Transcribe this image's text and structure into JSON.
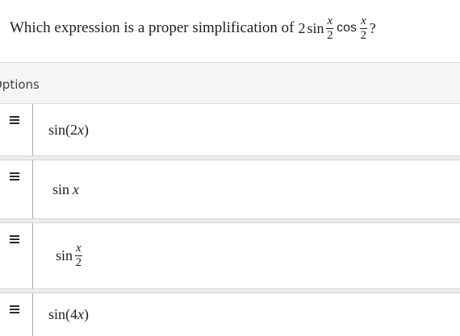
{
  "question": {
    "text": "Which expression is a proper simplification of",
    "coefficient": "2",
    "fn1": "sin",
    "fn2": "cos",
    "frac_numerator": "x",
    "frac_denominator": "2",
    "end": "?"
  },
  "faint_marks": "· · ·",
  "options_header": "Options",
  "options": [
    {
      "fn": "sin",
      "open": "(",
      "coef": "2",
      "var": "x",
      "close": ")"
    },
    {
      "fn": "sin",
      "var": "x"
    },
    {
      "fn": "sin",
      "frac_numerator": "x",
      "frac_denominator": "2"
    },
    {
      "fn": "sin",
      "open": "(",
      "coef": "4",
      "var": "x",
      "close": ")"
    }
  ],
  "handle_icon": "drag-handle-icon"
}
